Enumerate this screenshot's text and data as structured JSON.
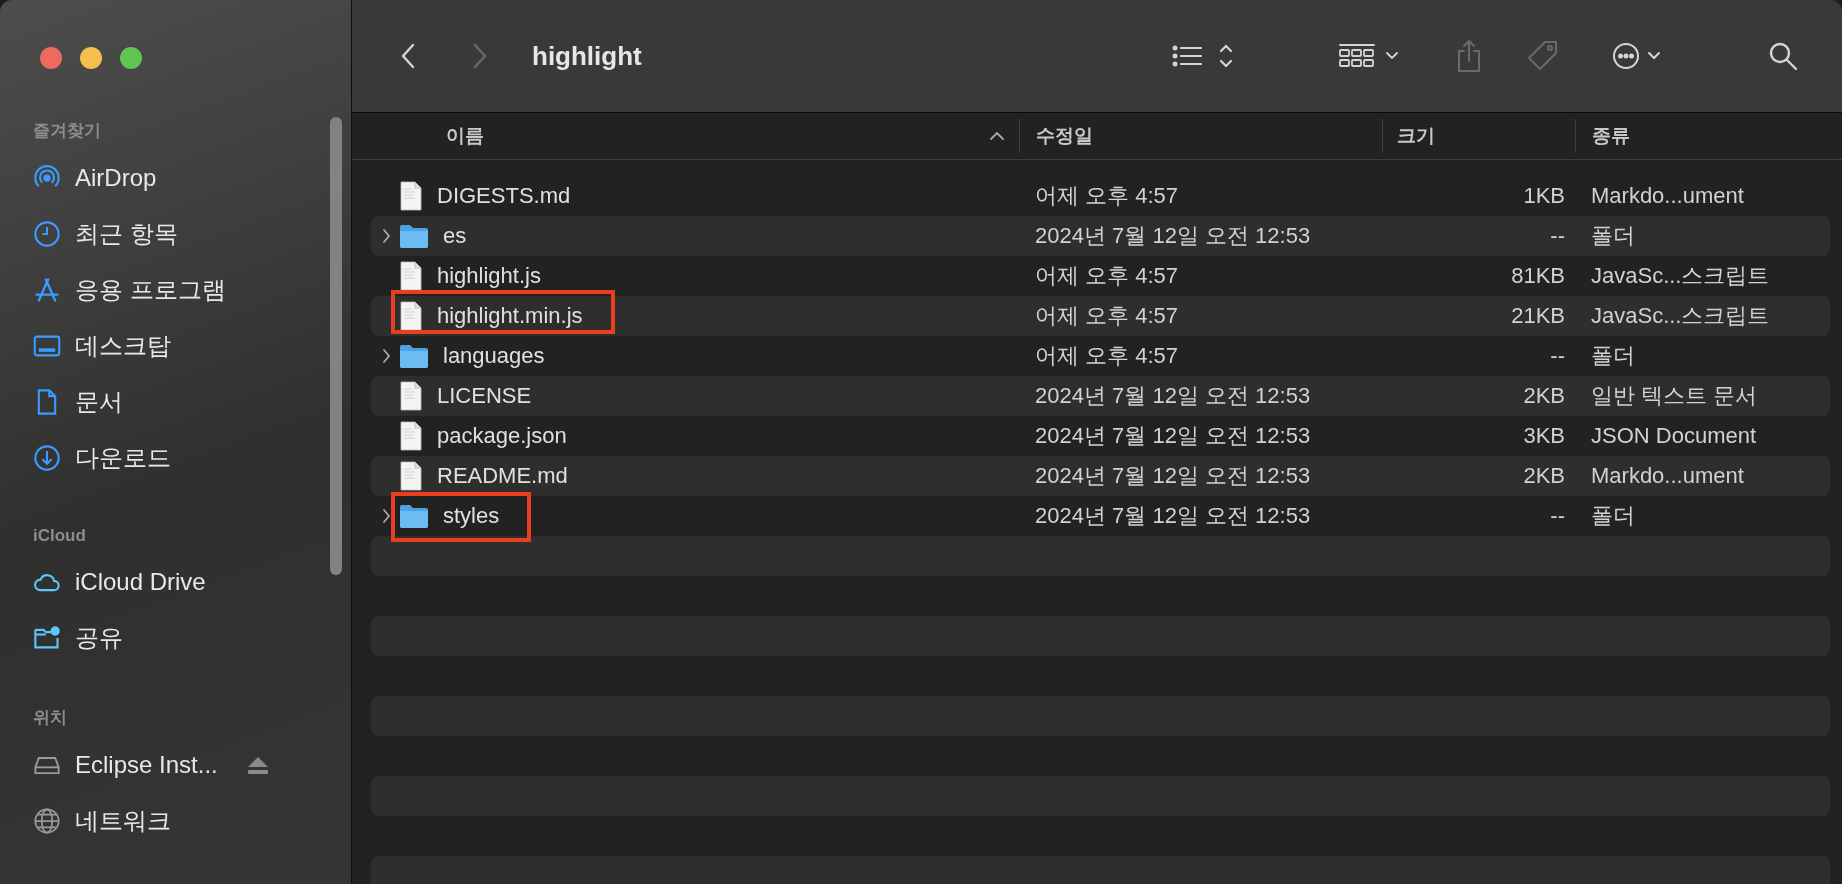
{
  "window": {
    "title": "highlight"
  },
  "toolbar": {
    "buttons": [
      {
        "kind": "back",
        "disabled": false
      },
      {
        "kind": "forward",
        "disabled": true
      },
      {
        "kind": "list-view",
        "disabled": false
      },
      {
        "kind": "grid-view",
        "disabled": false
      },
      {
        "kind": "share",
        "disabled": true
      },
      {
        "kind": "tag",
        "disabled": true
      },
      {
        "kind": "more",
        "disabled": false
      },
      {
        "kind": "search",
        "disabled": false
      }
    ]
  },
  "sidebar": {
    "sections": [
      {
        "heading": "즐겨찾기",
        "items": [
          {
            "label": "AirDrop",
            "kind": "airdrop"
          },
          {
            "label": "최근 항목",
            "kind": "recent"
          },
          {
            "label": "응용 프로그램",
            "kind": "apps"
          },
          {
            "label": "데스크탑",
            "kind": "desktop"
          },
          {
            "label": "문서",
            "kind": "documents"
          },
          {
            "label": "다운로드",
            "kind": "downloads"
          }
        ]
      },
      {
        "heading": "iCloud",
        "items": [
          {
            "label": "iCloud Drive",
            "kind": "cloud"
          },
          {
            "label": "공유",
            "kind": "shared"
          }
        ]
      },
      {
        "heading": "위치",
        "items": [
          {
            "label": "Eclipse Inst...",
            "kind": "disk",
            "ejectable": true
          },
          {
            "label": "네트워크",
            "kind": "network"
          }
        ]
      }
    ]
  },
  "table": {
    "columns": [
      {
        "label": "이름",
        "sorted": true
      },
      {
        "label": "수정일",
        "sorted": false
      },
      {
        "label": "크기",
        "sorted": false
      },
      {
        "label": "종류",
        "sorted": false
      }
    ],
    "rows": [
      {
        "kind": "file",
        "name": "DIGESTS.md",
        "date": "어제 오후 4:57",
        "size": "1KB",
        "type": "Markdo...ument",
        "annotated": false
      },
      {
        "kind": "folder",
        "expanded": false,
        "name": "es",
        "date": "2024년 7월 12일 오전 12:53",
        "size": "--",
        "type": "폴더",
        "annotated": false
      },
      {
        "kind": "file",
        "name": "highlight.js",
        "date": "어제 오후 4:57",
        "size": "81KB",
        "type": "JavaSc...스크립트",
        "annotated": false
      },
      {
        "kind": "file",
        "name": "highlight.min.js",
        "date": "어제 오후 4:57",
        "size": "21KB",
        "type": "JavaSc...스크립트",
        "annotated": true
      },
      {
        "kind": "folder",
        "expanded": false,
        "name": "languages",
        "date": "어제 오후 4:57",
        "size": "--",
        "type": "폴더",
        "annotated": false
      },
      {
        "kind": "file",
        "name": "LICENSE",
        "date": "2024년 7월 12일 오전 12:53",
        "size": "2KB",
        "type": "일반 텍스트 문서",
        "annotated": false
      },
      {
        "kind": "file",
        "name": "package.json",
        "date": "2024년 7월 12일 오전 12:53",
        "size": "3KB",
        "type": "JSON Document",
        "annotated": false
      },
      {
        "kind": "file",
        "name": "README.md",
        "date": "2024년 7월 12일 오전 12:53",
        "size": "2KB",
        "type": "Markdo...ument",
        "annotated": false
      },
      {
        "kind": "folder",
        "expanded": false,
        "name": "styles",
        "date": "2024년 7월 12일 오전 12:53",
        "size": "--",
        "type": "폴더",
        "annotated": true
      }
    ]
  }
}
